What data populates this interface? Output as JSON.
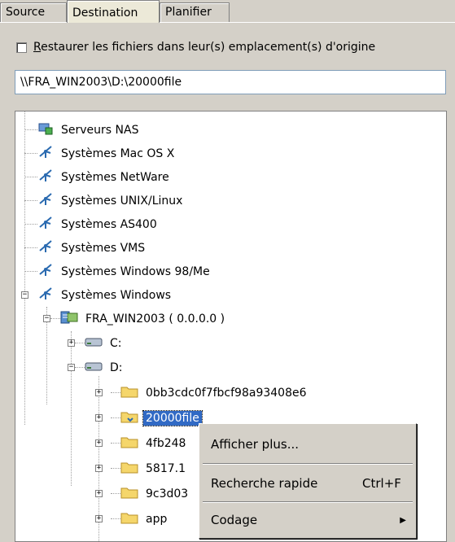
{
  "tabs": [
    "Source",
    "Destination",
    "Planifier"
  ],
  "restore_option": {
    "label": "estaurer les fichiers dans leur(s) emplacement(s) d'origine",
    "mnemonic": "R",
    "checked": false
  },
  "destination_path": "\\\\FRA_WIN2003\\D:\\20000file",
  "tree": {
    "nas": "Serveurs NAS",
    "mac": "Systèmes Mac OS X",
    "netware": "Systèmes NetWare",
    "unix": "Systèmes UNIX/Linux",
    "as400": "Systèmes AS400",
    "vms": "Systèmes VMS",
    "win98": "Systèmes Windows 98/Me",
    "windows": "Systèmes Windows",
    "server": "FRA_WIN2003 ( 0.0.0.0 )",
    "drive_c": "C:",
    "drive_d": "D:",
    "folders": [
      "0bb3cdc0f7fbcf98a93408e6",
      "20000file",
      "4fb248",
      "5817.1",
      "9c3d03",
      "app"
    ]
  },
  "context_menu": {
    "show_more": "Afficher plus...",
    "quick_search": "Recherche rapide",
    "quick_search_shortcut": "Ctrl+F",
    "encoding": "Codage"
  }
}
